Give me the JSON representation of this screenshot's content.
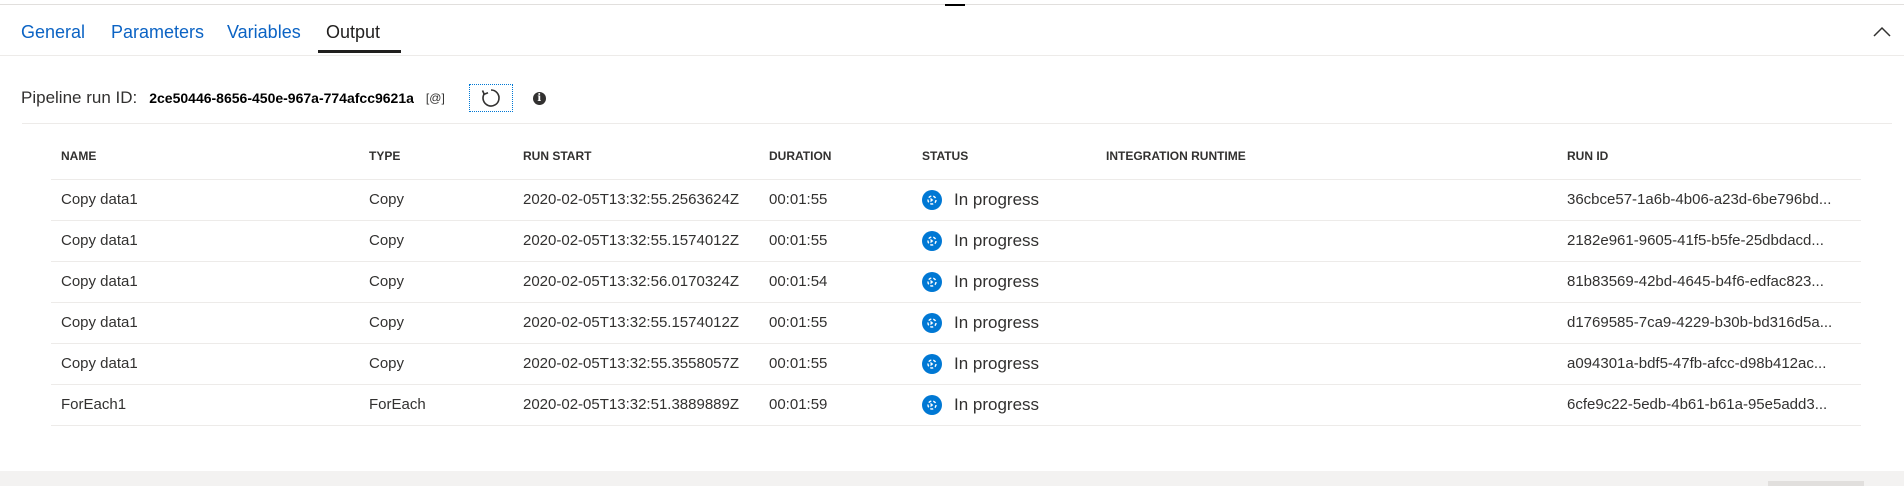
{
  "tabs": [
    {
      "label": "General"
    },
    {
      "label": "Parameters"
    },
    {
      "label": "Variables"
    },
    {
      "label": "Output"
    }
  ],
  "active_tab": "Output",
  "pipeline": {
    "run_id_label": "Pipeline run ID:",
    "run_id_value": "2ce50446-8656-450e-967a-774afcc9621a",
    "copy_label": "[@]"
  },
  "table": {
    "columns": [
      "NAME",
      "TYPE",
      "RUN START",
      "DURATION",
      "STATUS",
      "INTEGRATION RUNTIME",
      "RUN ID"
    ],
    "rows": [
      {
        "name": "Copy data1",
        "type": "Copy",
        "run_start": "2020-02-05T13:32:55.2563624Z",
        "duration": "00:01:55",
        "status": "In progress",
        "integration_runtime": "",
        "run_id": "36cbce57-1a6b-4b06-a23d-6be796bd..."
      },
      {
        "name": "Copy data1",
        "type": "Copy",
        "run_start": "2020-02-05T13:32:55.1574012Z",
        "duration": "00:01:55",
        "status": "In progress",
        "integration_runtime": "",
        "run_id": "2182e961-9605-41f5-b5fe-25dbdacd..."
      },
      {
        "name": "Copy data1",
        "type": "Copy",
        "run_start": "2020-02-05T13:32:56.0170324Z",
        "duration": "00:01:54",
        "status": "In progress",
        "integration_runtime": "",
        "run_id": "81b83569-42bd-4645-b4f6-edfac823..."
      },
      {
        "name": "Copy data1",
        "type": "Copy",
        "run_start": "2020-02-05T13:32:55.1574012Z",
        "duration": "00:01:55",
        "status": "In progress",
        "integration_runtime": "",
        "run_id": "d1769585-7ca9-4229-b30b-bd316d5a..."
      },
      {
        "name": "Copy data1",
        "type": "Copy",
        "run_start": "2020-02-05T13:32:55.3558057Z",
        "duration": "00:01:55",
        "status": "In progress",
        "integration_runtime": "",
        "run_id": "a094301a-bdf5-47fb-afcc-d98b412ac..."
      },
      {
        "name": "ForEach1",
        "type": "ForEach",
        "run_start": "2020-02-05T13:32:51.3889889Z",
        "duration": "00:01:59",
        "status": "In progress",
        "integration_runtime": "",
        "run_id": "6cfe9c22-5edb-4b61-b61a-95e5add3..."
      }
    ]
  },
  "icons": {
    "collapse": "chevron-up-icon",
    "refresh": "refresh-icon",
    "info": "info-icon",
    "status": "in-progress-icon"
  },
  "colors": {
    "accent": "#0078d4",
    "link": "#0b63c4"
  }
}
